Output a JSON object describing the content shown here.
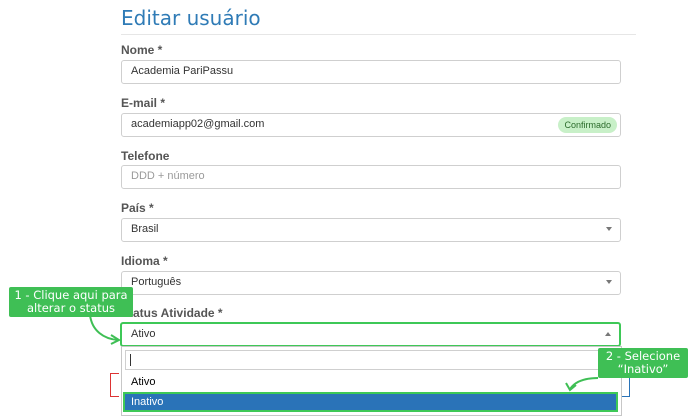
{
  "page": {
    "title": "Editar usuário"
  },
  "form": {
    "nome": {
      "label": "Nome *",
      "value": "Academia PariPassu"
    },
    "email": {
      "label": "E-mail *",
      "value": "academiapp02@gmail.com",
      "badge": "Confirmado"
    },
    "telefone": {
      "label": "Telefone",
      "placeholder": "DDD + número"
    },
    "pais": {
      "label": "País *",
      "value": "Brasil"
    },
    "idioma": {
      "label": "Idioma *",
      "value": "Português"
    },
    "status": {
      "label": "Status Atividade *",
      "value": "Ativo",
      "options": [
        "Ativo",
        "Inativo"
      ],
      "highlighted": "Inativo"
    }
  },
  "annotations": {
    "callout1": "1 - Clique aqui para\nalterar o status",
    "callout1_l1": "1 - Clique aqui para",
    "callout1_l2": "alterar o status",
    "callout2_l1": "2 - Selecione",
    "callout2_l2": "“Inativo”"
  },
  "colors": {
    "accent": "#2f7bb6",
    "highlight": "#3ec857",
    "selected": "#2a73b8",
    "badge": "#c8f0c8"
  }
}
